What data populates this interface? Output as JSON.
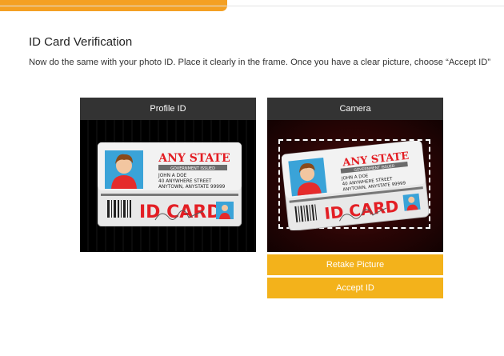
{
  "progress": {
    "fraction": 0.45,
    "color": "#f4a023"
  },
  "page": {
    "title": "ID Card Verification",
    "instructions": "Now do the same with your photo ID. Place it clearly in the frame. Once you have a clear picture, choose “Accept ID”"
  },
  "profile_panel": {
    "header": "Profile ID"
  },
  "camera_panel": {
    "header": "Camera"
  },
  "id_card": {
    "state": "ANY STATE",
    "issued": "GOVERNMENT ISSUED",
    "name": "JOHN A DOE",
    "street": "40 ANYWHERE STREET",
    "city": "ANYTOWN, ANYSTATE 99999",
    "card_label": "ID CARD",
    "signature_icon": "signature-icon"
  },
  "buttons": {
    "retake": "Retake Picture",
    "accept": "Accept ID"
  },
  "colors": {
    "accent": "#f3b21b",
    "header_bg": "#333333",
    "card_red": "#e31e24"
  }
}
